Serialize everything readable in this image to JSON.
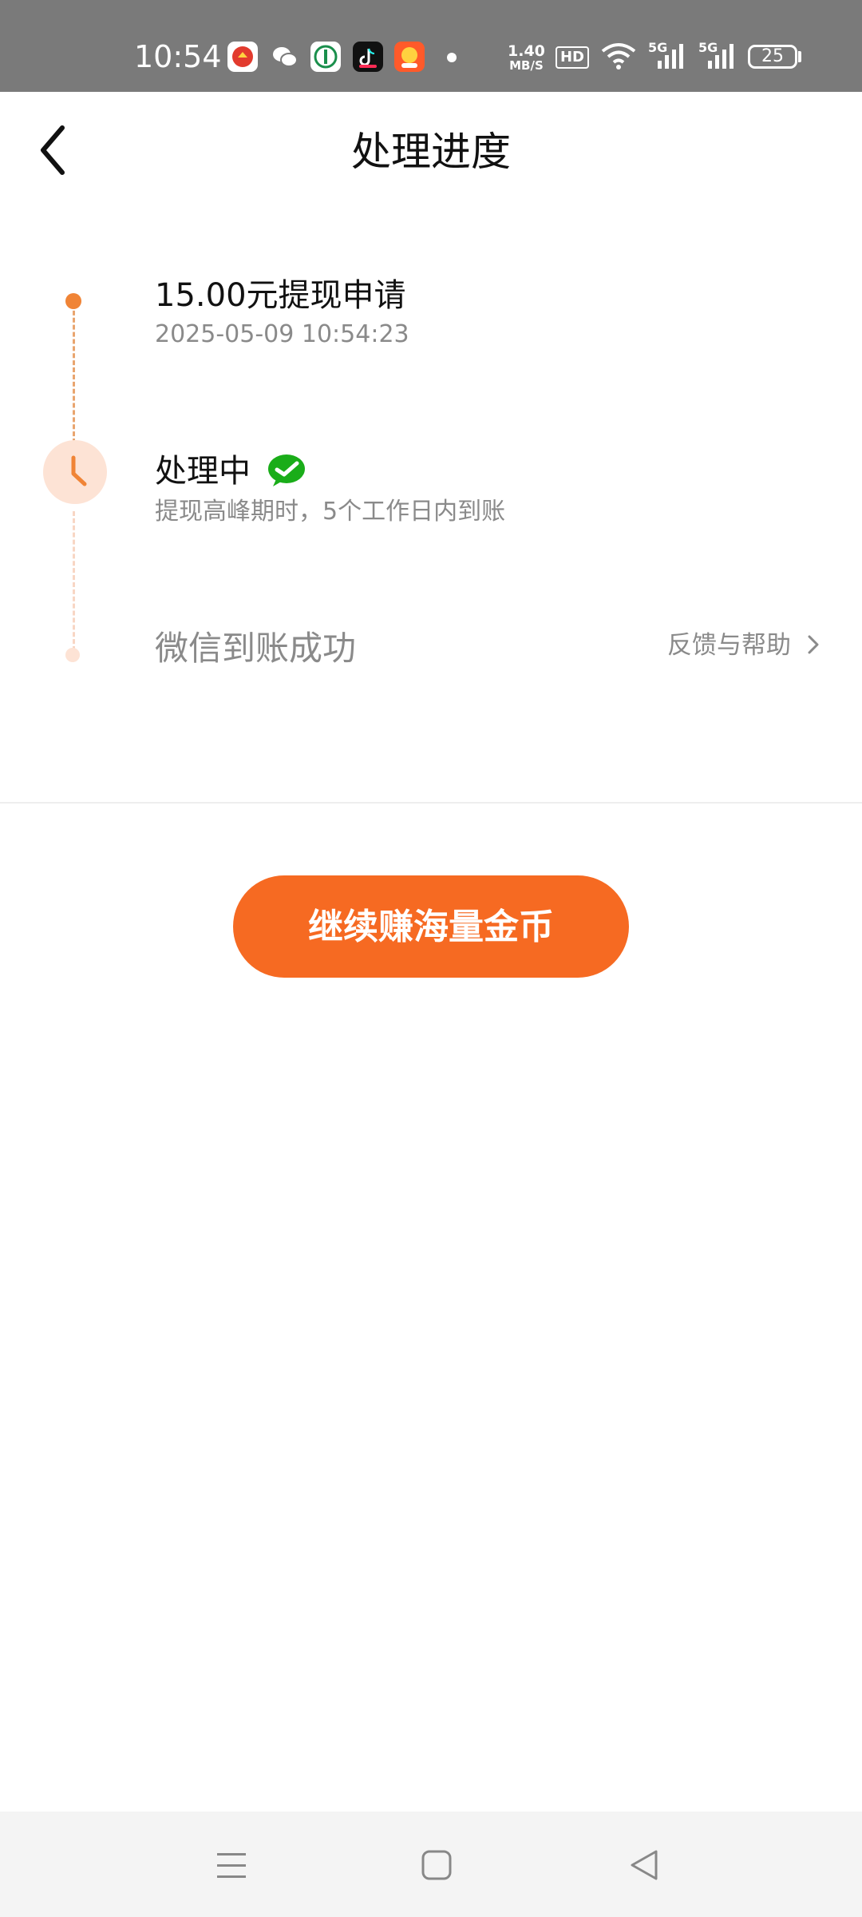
{
  "status_bar": {
    "time": "10:54",
    "net_speed_value": "1.40",
    "net_speed_unit": "MB/S",
    "hd_label": "HD",
    "signal1_label": "5G",
    "signal2_label": "5G",
    "battery": "25"
  },
  "header": {
    "title": "处理进度",
    "back_icon": "chevron-left-icon"
  },
  "timeline": {
    "steps": [
      {
        "title": "15.00元提现申请",
        "subtitle": "2025-05-09 10:54:23",
        "status": "done"
      },
      {
        "title": "处理中",
        "subtitle": "提现高峰期时，5个工作日内到账",
        "status": "processing",
        "icon": "wechat-icon"
      },
      {
        "title": "微信到账成功",
        "status": "pending"
      }
    ]
  },
  "feedback": {
    "label": "反馈与帮助"
  },
  "cta": {
    "label": "继续赚海量金币"
  },
  "colors": {
    "accent": "#f66a22",
    "timeline_active": "#f08436",
    "timeline_pending": "#fde3d5",
    "wechat_green": "#1aad19"
  },
  "nav_bar": {
    "menu_icon": "menu-icon",
    "home_icon": "home-square-icon",
    "back_icon": "back-triangle-icon"
  }
}
